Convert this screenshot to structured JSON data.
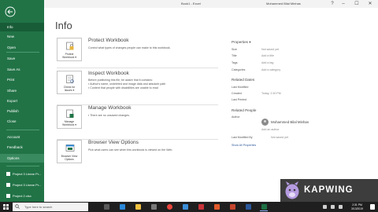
{
  "titlebar": {
    "title": "Book1 - Excel",
    "user": "Mohammed Bilal Minhas",
    "help": "?",
    "minimize": "–",
    "maximize": "☐",
    "close": "✕"
  },
  "backstage": {
    "items": [
      {
        "label": "Info",
        "state": "active"
      },
      {
        "label": "New"
      },
      {
        "label": "Open"
      },
      {
        "label": "Save"
      },
      {
        "label": "Save As"
      },
      {
        "label": "Print"
      },
      {
        "label": "Share"
      },
      {
        "label": "Export"
      },
      {
        "label": "Publish"
      },
      {
        "label": "Close"
      },
      {
        "label": "Account"
      },
      {
        "label": "Feedback"
      },
      {
        "label": "Options",
        "state": "hover"
      }
    ],
    "recent": [
      {
        "label": "Project 3 Linear Pr..."
      },
      {
        "label": "Project 3 Linear Pr..."
      },
      {
        "label": "Project 2.xlsx"
      }
    ]
  },
  "info": {
    "title": "Info",
    "sections": [
      {
        "tile_label_1": "Protect",
        "tile_label_2": "Workbook ▾",
        "title": "Protect Workbook",
        "lines": [
          "Control what types of changes people can make to this workbook."
        ],
        "bullets": []
      },
      {
        "tile_label_1": "Check for",
        "tile_label_2": "Issues ▾",
        "title": "Inspect Workbook",
        "lines": [
          "Before publishing this file, be aware that it contains:"
        ],
        "bullets": [
          "Author's name, undeleted and image data and absolute path",
          "Content that people with disabilities are unable to read"
        ]
      },
      {
        "tile_label_1": "Manage",
        "tile_label_2": "Workbook ▾",
        "title": "Manage Workbook",
        "lines": [],
        "bullets": [
          "There are no unsaved changes."
        ]
      },
      {
        "tile_label_1": "Browser View",
        "tile_label_2": "Options",
        "title": "Browser View Options",
        "lines": [
          "Pick what users can see when this workbook is viewed on the Web."
        ],
        "bullets": []
      }
    ]
  },
  "properties": {
    "heading": "Properties ▾",
    "rows": [
      {
        "label": "Size",
        "value": "Not saved yet"
      },
      {
        "label": "Title",
        "value": "Add a title"
      },
      {
        "label": "Tags",
        "value": "Add a tag"
      },
      {
        "label": "Categories",
        "value": "Add a category"
      }
    ],
    "dates_heading": "Related Dates",
    "dates": [
      {
        "label": "Last Modified",
        "value": ""
      },
      {
        "label": "Created",
        "value": "Today, 2:30 PM"
      },
      {
        "label": "Last Printed",
        "value": ""
      }
    ],
    "people_heading": "Related People",
    "author_label": "Author",
    "author_name": "Mohammed Bilal Minhas",
    "add_author": "Add an author",
    "modified_by_label": "Last Modified By",
    "modified_by_value": "Not saved yet",
    "show_all": "Show All Properties"
  },
  "watermark": {
    "text": "KAPWING"
  },
  "taskbar": {
    "search_placeholder": "Type here to search",
    "time": "2:31 PM",
    "date": "3/13/2019",
    "colors": {
      "excel": "#1e7145",
      "edge": "#2b88d8",
      "explorer": "#f0c040",
      "store": "#5a5a5a",
      "chrome": "#e8453c",
      "mail": "#3c8fd8",
      "red_app": "#c8333a",
      "ppt": "#c5462d",
      "word": "#2b579a"
    }
  },
  "colors": {
    "brand_green": "#217346",
    "active_green": "#185c37",
    "link_blue": "#2b579a"
  }
}
